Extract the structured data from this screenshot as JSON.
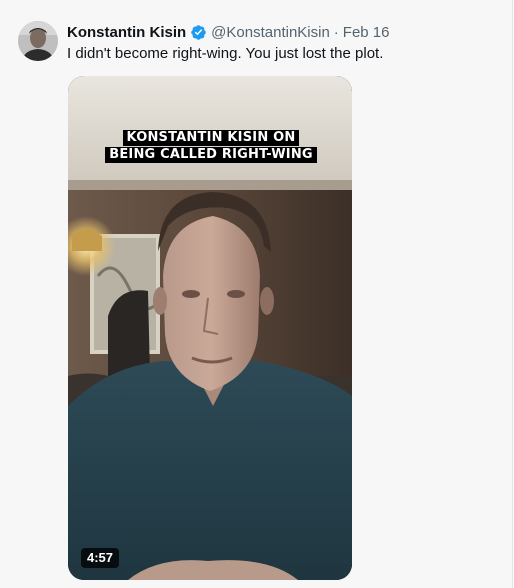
{
  "tweet": {
    "author_name": "Konstantin Kisin",
    "author_handle": "@KonstantinKisin",
    "separator": "·",
    "date": "Feb 16",
    "text": "I didn't become right-wing. You just lost the plot."
  },
  "media": {
    "type": "video",
    "caption_line1": "KONSTANTIN KISIN ON",
    "caption_line2": "BEING CALLED RIGHT-WING",
    "duration": "4:57"
  },
  "icons": {
    "verified": "verified-badge-icon"
  },
  "colors": {
    "verified_blue": "#1d9bf0",
    "text_primary": "#0f1419",
    "text_secondary": "#536471"
  }
}
